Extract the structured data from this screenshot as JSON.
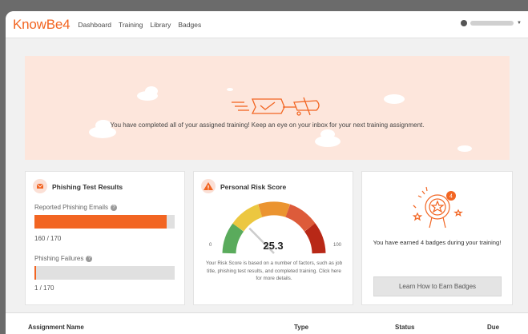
{
  "app": {
    "logo": "KnowBe4",
    "nav": [
      "Dashboard",
      "Training",
      "Library",
      "Badges"
    ],
    "user_name": "",
    "brand_color": "#f26522"
  },
  "banner": {
    "message": "You have completed all of your assigned training! Keep an eye on your inbox for your next training assignment."
  },
  "phishing": {
    "title": "Phishing Test Results",
    "reported_label": "Reported Phishing Emails",
    "reported_count": "160 / 170",
    "reported_fraction": 0.941,
    "failures_label": "Phishing Failures",
    "failures_count": "1 / 170",
    "failures_fraction": 0.0059
  },
  "risk": {
    "title": "Personal Risk Score",
    "value": "25.3",
    "min": "0",
    "max": "100",
    "score": 25.3,
    "description": "Your Risk Score is based on a number of factors, such as job title, phishing test results, and completed training. Click here for more details."
  },
  "badges": {
    "count": "4",
    "message": "You have earned 4 badges during your training!",
    "button_label": "Learn How to Earn Badges"
  },
  "table": {
    "headers": [
      "Assignment Name",
      "Type",
      "Status",
      "Due"
    ]
  }
}
